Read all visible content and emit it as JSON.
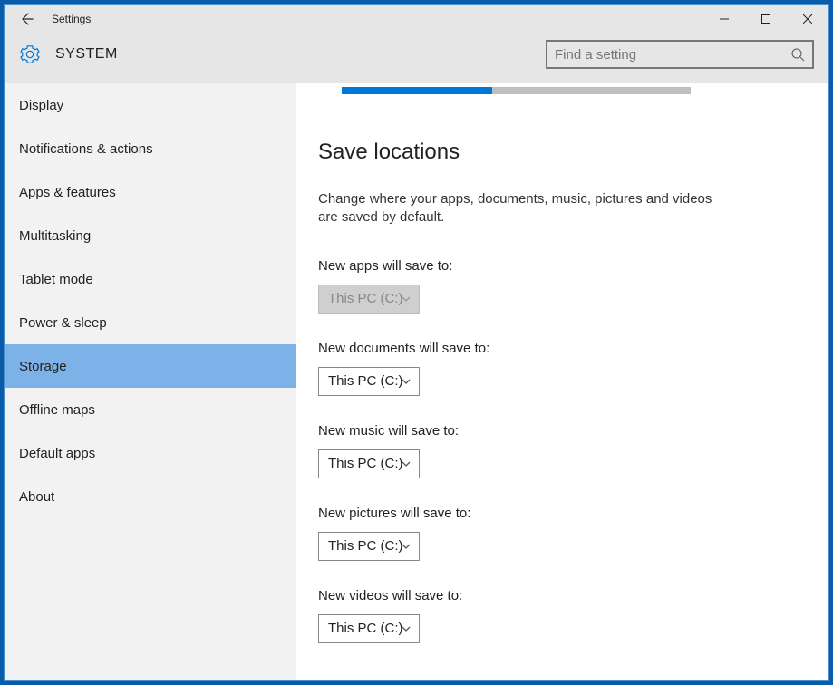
{
  "window": {
    "title": "Settings",
    "section": "SYSTEM"
  },
  "search": {
    "placeholder": "Find a setting"
  },
  "sidebar": {
    "items": [
      {
        "label": "Display",
        "selected": false
      },
      {
        "label": "Notifications & actions",
        "selected": false
      },
      {
        "label": "Apps & features",
        "selected": false
      },
      {
        "label": "Multitasking",
        "selected": false
      },
      {
        "label": "Tablet mode",
        "selected": false
      },
      {
        "label": "Power & sleep",
        "selected": false
      },
      {
        "label": "Storage",
        "selected": true
      },
      {
        "label": "Offline maps",
        "selected": false
      },
      {
        "label": "Default apps",
        "selected": false
      },
      {
        "label": "About",
        "selected": false
      }
    ]
  },
  "progress": {
    "percent": 43
  },
  "main": {
    "heading": "Save locations",
    "description": "Change where your apps, documents, music, pictures and videos are saved by default.",
    "fields": [
      {
        "label": "New apps will save to:",
        "value": "This PC (C:)",
        "disabled": true
      },
      {
        "label": "New documents will save to:",
        "value": "This PC (C:)",
        "disabled": false
      },
      {
        "label": "New music will save to:",
        "value": "This PC (C:)",
        "disabled": false
      },
      {
        "label": "New pictures will save to:",
        "value": "This PC (C:)",
        "disabled": false
      },
      {
        "label": "New videos will save to:",
        "value": "This PC (C:)",
        "disabled": false
      }
    ]
  }
}
